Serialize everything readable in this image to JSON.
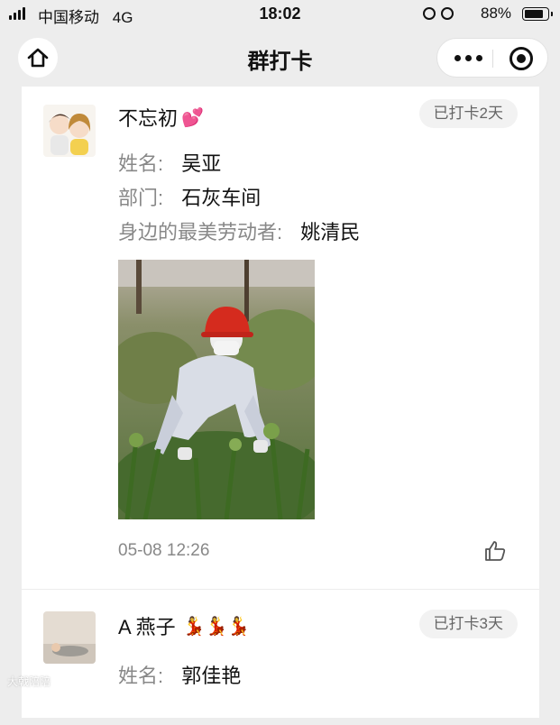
{
  "status_bar": {
    "carrier": "中国移动",
    "network": "4G",
    "time": "18:02",
    "battery": "88%"
  },
  "nav": {
    "title": "群打卡",
    "back_icon": "home-icon",
    "more_icon": "more-dots-icon",
    "close_icon": "target-close-icon"
  },
  "posts": [
    {
      "name": "不忘初",
      "name_emoji": "💕",
      "badge": "已打卡2天",
      "fields": [
        {
          "label": "姓名:",
          "value": "吴亚"
        },
        {
          "label": "部门:",
          "value": "石灰车间"
        },
        {
          "label": "身边的最美劳动者:",
          "value": "姚清民"
        }
      ],
      "timestamp": "05-08 12:26"
    },
    {
      "name": "A 燕子",
      "name_emoji": "💃💃💃",
      "badge": "已打卡3天",
      "fields": [
        {
          "label": "姓名:",
          "value": "郭佳艳"
        }
      ]
    }
  ],
  "watermark": "大戟陪陪",
  "colors": {
    "background": "#ededed",
    "card": "#ffffff",
    "badge_bg": "#f2f2f2",
    "muted_text": "#888888"
  }
}
